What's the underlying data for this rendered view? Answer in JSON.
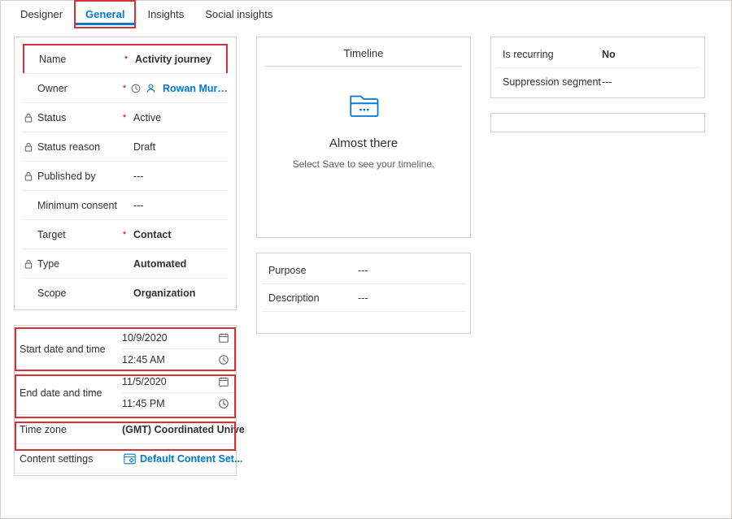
{
  "tabs": {
    "designer": "Designer",
    "general": "General",
    "insights": "Insights",
    "social_insights": "Social insights"
  },
  "general": {
    "name_label": "Name",
    "name_value": "Activity journey",
    "owner_label": "Owner",
    "owner_value": "Rowan Murphy",
    "status_label": "Status",
    "status_value": "Active",
    "status_reason_label": "Status reason",
    "status_reason_value": "Draft",
    "published_by_label": "Published by",
    "published_by_value": "---",
    "min_consent_label": "Minimum consent",
    "min_consent_value": "---",
    "target_label": "Target",
    "target_value": "Contact",
    "type_label": "Type",
    "type_value": "Automated",
    "scope_label": "Scope",
    "scope_value": "Organization"
  },
  "schedule": {
    "start_label": "Start date and time",
    "start_date": "10/9/2020",
    "start_time": "12:45 AM",
    "end_label": "End date and time",
    "end_date": "11/5/2020",
    "end_time": "11:45 PM",
    "tz_label": "Time zone",
    "tz_value": "(GMT) Coordinated Unive",
    "content_label": "Content settings",
    "content_value": "Default Content Set..."
  },
  "timeline": {
    "title": "Timeline",
    "heading": "Almost there",
    "sub": "Select Save to see your timeline."
  },
  "meta": {
    "purpose_label": "Purpose",
    "purpose_value": "---",
    "description_label": "Description",
    "description_value": "---"
  },
  "right": {
    "recurring_label": "Is recurring",
    "recurring_value": "No",
    "suppression_label": "Suppression segment",
    "suppression_value": "---"
  }
}
